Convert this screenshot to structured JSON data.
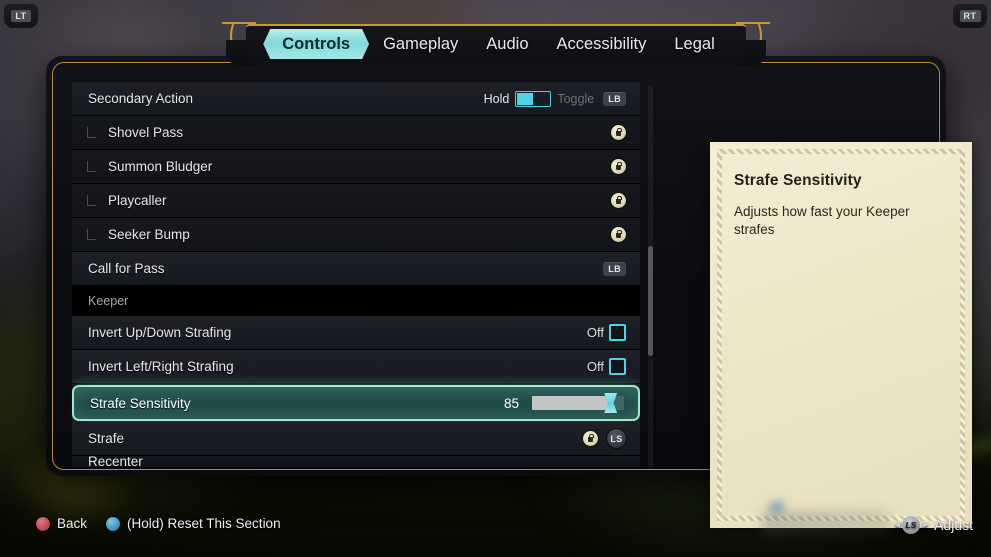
{
  "tabs": {
    "left_bumper": "LT",
    "right_bumper": "RT",
    "items": [
      {
        "label": "Controls",
        "active": true
      },
      {
        "label": "Gameplay",
        "active": false
      },
      {
        "label": "Audio",
        "active": false
      },
      {
        "label": "Accessibility",
        "active": false
      },
      {
        "label": "Legal",
        "active": false
      }
    ]
  },
  "settings": {
    "rows": [
      {
        "name": "secondary-action",
        "label": "Secondary Action",
        "type": "switch",
        "switch_left": "Hold",
        "switch_right": "Toggle",
        "switch_value": "Hold",
        "binding": "LB"
      },
      {
        "name": "shovel-pass",
        "label": "Shovel Pass",
        "type": "locked",
        "child": true
      },
      {
        "name": "summon-bludger",
        "label": "Summon Bludger",
        "type": "locked",
        "child": true
      },
      {
        "name": "playcaller",
        "label": "Playcaller",
        "type": "locked",
        "child": true
      },
      {
        "name": "seeker-bump",
        "label": "Seeker Bump",
        "type": "locked",
        "child": true
      },
      {
        "name": "call-for-pass",
        "label": "Call for Pass",
        "type": "binding",
        "binding": "LB"
      },
      {
        "name": "keeper-section",
        "label": "Keeper",
        "type": "section"
      },
      {
        "name": "invert-up-down",
        "label": "Invert Up/Down Strafing",
        "type": "checkbox",
        "value": "Off",
        "checked": false
      },
      {
        "name": "invert-left-right",
        "label": "Invert Left/Right Strafing",
        "type": "checkbox",
        "value": "Off",
        "checked": false
      },
      {
        "name": "strafe-sensitivity",
        "label": "Strafe Sensitivity",
        "type": "slider",
        "value": "85",
        "percent": 85,
        "selected": true
      },
      {
        "name": "strafe",
        "label": "Strafe",
        "type": "locked-binding",
        "binding": "LS"
      },
      {
        "name": "recenter",
        "label": "Recenter",
        "type": "cutoff"
      }
    ]
  },
  "description": {
    "title": "Strafe Sensitivity",
    "body": "Adjusts how fast your Keeper strafes"
  },
  "footer": {
    "back_label": "Back",
    "reset_label": "(Hold) Reset This Section",
    "adjust_label": "Adjust",
    "adjust_stick": "LS"
  },
  "colors": {
    "accent_cyan": "#4fd2e6",
    "gold_border": "#b8912f",
    "selected_border": "#9fe7cf",
    "parchment": "#efe6c9"
  }
}
